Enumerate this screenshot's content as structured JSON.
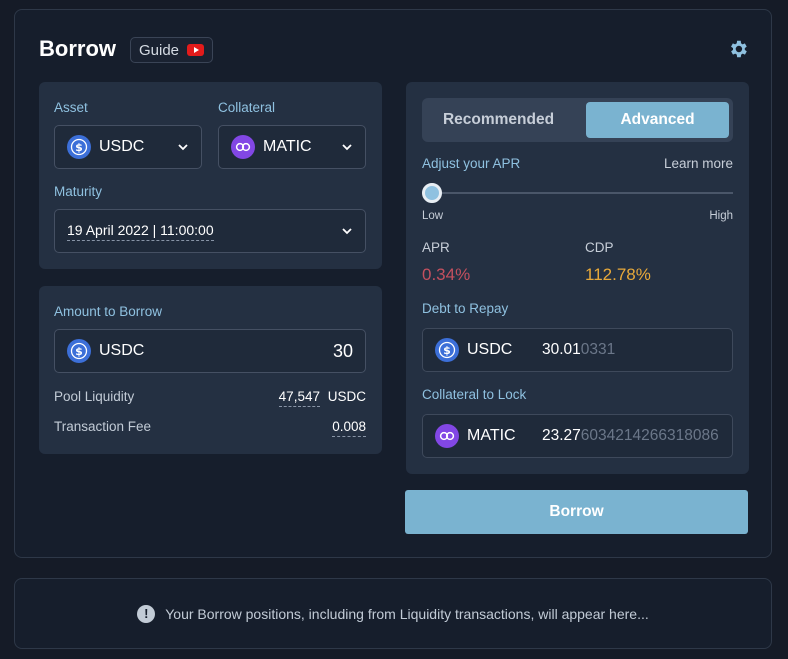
{
  "header": {
    "title": "Borrow",
    "guide_label": "Guide"
  },
  "asset_panel": {
    "asset_label": "Asset",
    "asset_value": "USDC",
    "collateral_label": "Collateral",
    "collateral_value": "MATIC",
    "maturity_label": "Maturity",
    "maturity_value": "19 April 2022 | 11:00:00"
  },
  "amount_panel": {
    "label": "Amount to Borrow",
    "asset": "USDC",
    "amount": "30",
    "pool_liquidity_label": "Pool Liquidity",
    "pool_liquidity_value": "47,547",
    "pool_liquidity_unit": "USDC",
    "fee_label": "Transaction Fee",
    "fee_value": "0.008"
  },
  "apr_panel": {
    "tabs": [
      {
        "label": "Recommended",
        "active": false
      },
      {
        "label": "Advanced",
        "active": true
      }
    ],
    "adjust_label": "Adjust your APR",
    "learn_more": "Learn more",
    "slider_low": "Low",
    "slider_high": "High",
    "slider_level": 0,
    "apr_label": "APR",
    "apr_value": "0.34%",
    "cdp_label": "CDP",
    "cdp_value": "112.78%",
    "debt_label": "Debt to Repay",
    "debt_asset": "USDC",
    "debt_main": "30.01",
    "debt_dim": "0331",
    "collateral_lock_label": "Collateral to Lock",
    "collateral_asset": "MATIC",
    "collateral_main": "23.27",
    "collateral_dim": "6034214266318086"
  },
  "actions": {
    "borrow_label": "Borrow"
  },
  "notice": {
    "text": "Your Borrow positions, including from Liquidity transactions, will appear here..."
  },
  "colors": {
    "accent": "#7ab3d0",
    "label_blue": "#8fc1e0",
    "apr_red": "#c4505f",
    "cdp_orange": "#e8a93a",
    "usdc_blue": "#3c6fd8",
    "matic_purple": "#8247e5"
  },
  "icons": [
    "youtube-icon",
    "gear-icon",
    "usdc-icon",
    "matic-icon",
    "chevron-down-icon",
    "info-icon"
  ]
}
